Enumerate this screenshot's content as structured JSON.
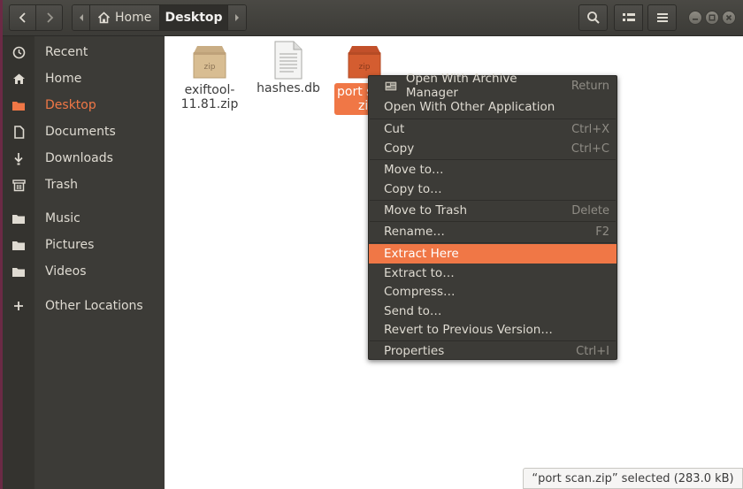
{
  "header": {
    "path_home": "Home",
    "path_current": "Desktop"
  },
  "sidebar": {
    "items": [
      {
        "label": "Recent",
        "icon": "clock-icon"
      },
      {
        "label": "Home",
        "icon": "home-icon"
      },
      {
        "label": "Desktop",
        "icon": "folder-icon",
        "active": true
      },
      {
        "label": "Documents",
        "icon": "document-icon"
      },
      {
        "label": "Downloads",
        "icon": "download-icon"
      },
      {
        "label": "Trash",
        "icon": "trash-icon"
      },
      {
        "label": "Music",
        "icon": "folder-icon"
      },
      {
        "label": "Pictures",
        "icon": "folder-icon"
      },
      {
        "label": "Videos",
        "icon": "folder-icon"
      },
      {
        "label": "Other Locations",
        "icon": "plus-icon"
      }
    ]
  },
  "files": [
    {
      "name_line1": "exiftool-",
      "name_line2": "11.81.zip",
      "icon": "zip-archive-icon"
    },
    {
      "name_line1": "hashes.db",
      "name_line2": "",
      "icon": "text-file-icon"
    },
    {
      "name_line1": "port s",
      "name_line2": "zi",
      "icon": "zip-archive-icon",
      "selected": true
    }
  ],
  "context_menu": {
    "items": [
      {
        "label": "Open With Archive Manager",
        "accel": "Return"
      },
      {
        "label": "Open With Other Application",
        "accel": ""
      },
      {
        "label": "Cut",
        "accel": "Ctrl+X"
      },
      {
        "label": "Copy",
        "accel": "Ctrl+C"
      },
      {
        "label": "Move to…",
        "accel": ""
      },
      {
        "label": "Copy to…",
        "accel": ""
      },
      {
        "label": "Move to Trash",
        "accel": "Delete"
      },
      {
        "label": "Rename…",
        "accel": "F2"
      },
      {
        "label": "Extract Here",
        "accel": "",
        "highlighted": true
      },
      {
        "label": "Extract to…",
        "accel": ""
      },
      {
        "label": "Compress…",
        "accel": ""
      },
      {
        "label": "Send to…",
        "accel": ""
      },
      {
        "label": "Revert to Previous Version…",
        "accel": ""
      },
      {
        "label": "Properties",
        "accel": "Ctrl+I"
      }
    ]
  },
  "status": {
    "text": "“port scan.zip” selected  (283.0 kB)"
  },
  "colors": {
    "accent": "#f07746",
    "sidebar_bg": "#3c3b37",
    "header_bg": "#3c3b37"
  }
}
